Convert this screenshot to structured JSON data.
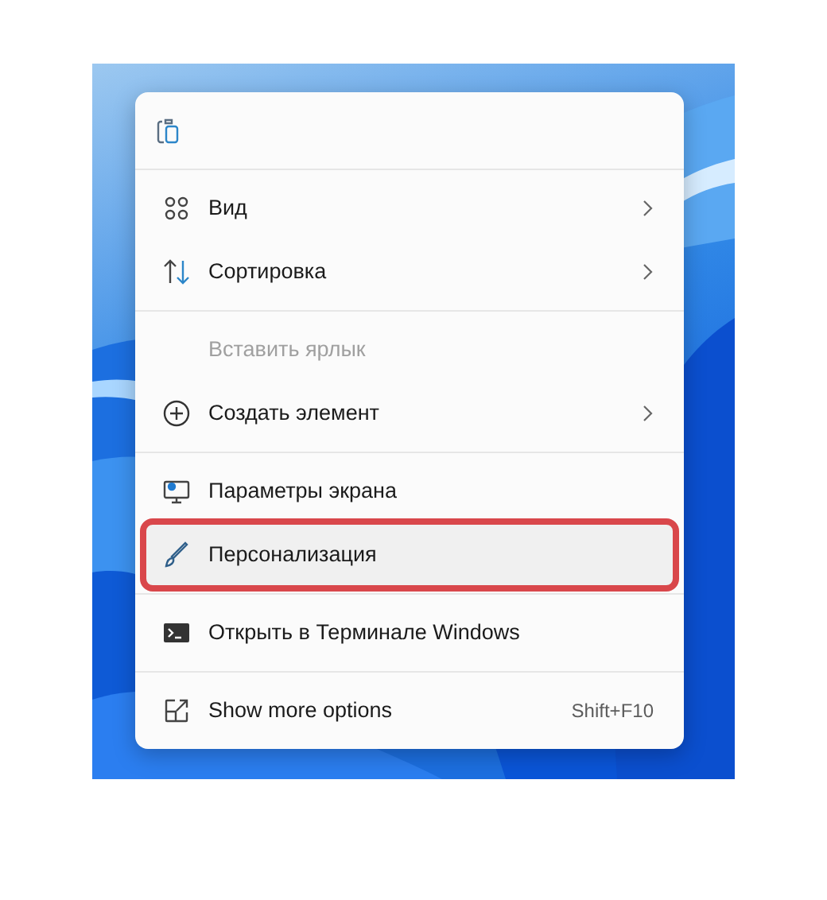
{
  "menu": {
    "sections": [
      [
        {
          "kind": "view",
          "label": "Вид",
          "disabled": false,
          "submenu": true,
          "selected": false
        },
        {
          "kind": "sort",
          "label": "Сортировка",
          "disabled": false,
          "submenu": true,
          "selected": false
        }
      ],
      [
        {
          "kind": "blank",
          "label": "Вставить ярлык",
          "disabled": true,
          "submenu": false,
          "selected": false
        },
        {
          "kind": "new",
          "label": "Создать элемент",
          "disabled": false,
          "submenu": true,
          "selected": false
        }
      ],
      [
        {
          "kind": "display",
          "label": "Параметры экрана",
          "disabled": false,
          "submenu": false,
          "selected": false
        },
        {
          "kind": "brush",
          "label": "Персонализация",
          "disabled": false,
          "submenu": false,
          "selected": true
        }
      ],
      [
        {
          "kind": "terminal",
          "label": "Открыть в Терминале Windows",
          "disabled": false,
          "submenu": false,
          "selected": false
        }
      ],
      [
        {
          "kind": "more",
          "label": "Show more options",
          "disabled": false,
          "submenu": false,
          "selected": false,
          "shortcut": "Shift+F10"
        }
      ]
    ]
  }
}
